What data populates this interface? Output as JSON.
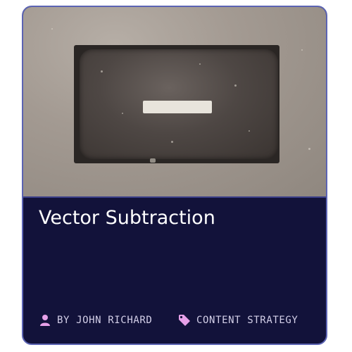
{
  "card": {
    "title": "Vector Subtraction",
    "author": "BY JOHN RICHARD",
    "category": "CONTENT STRATEGY",
    "icons": {
      "author": "user-icon",
      "category": "tag-icon"
    },
    "colors": {
      "card_background": "#12123a",
      "border": "#5b63b3",
      "icon_accent": "#e6a0e8",
      "meta_text": "#d3cfe8",
      "title_text": "#ffffff"
    }
  }
}
